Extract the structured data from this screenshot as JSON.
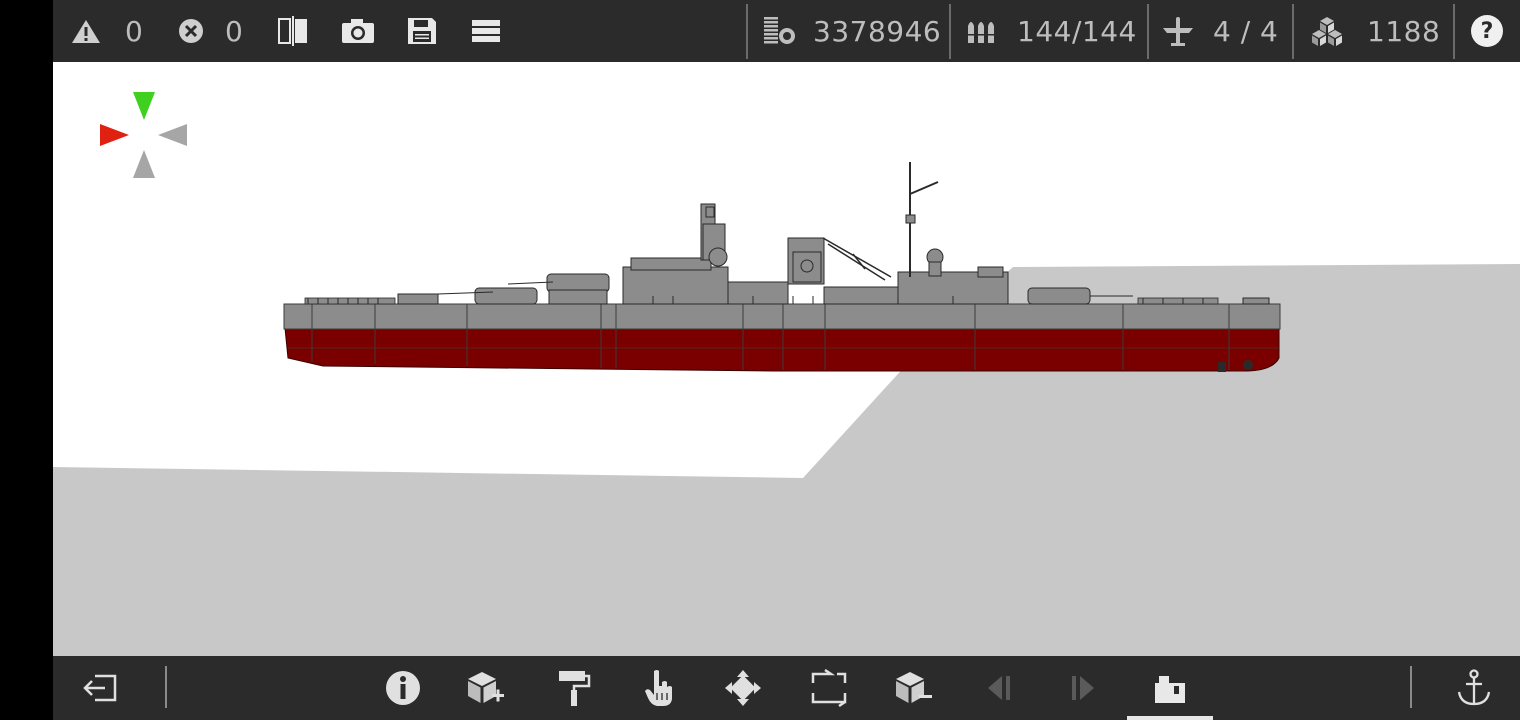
{
  "topbar": {
    "warnings_count": "0",
    "errors_count": "0",
    "cost_value": "3378946",
    "ammo_value": "144/144",
    "aircraft_value": "4 / 4",
    "parts_value": "1188",
    "help_label": "?"
  },
  "colors": {
    "bar_background": "#2b2b2b",
    "hull_upper": "#8c8c8c",
    "hull_lower": "#7a0000",
    "water_plane": "#c8c8c8",
    "axis_red": "#e02010",
    "axis_green": "#3fd020",
    "axis_gray": "#a6a6a6"
  },
  "bottombar": {
    "active_tool": "view-mode"
  },
  "icons": {
    "top": [
      "warning-icon",
      "error-icon",
      "mirror-icon",
      "camera-icon",
      "save-icon",
      "menu-icon",
      "cost-icon",
      "ammo-icon",
      "aircraft-icon",
      "parts-icon",
      "help-icon"
    ],
    "bottom": [
      "exit-icon",
      "info-icon",
      "add-part-icon",
      "paint-icon",
      "select-icon",
      "move-icon",
      "transform-icon",
      "remove-part-icon",
      "previous-icon",
      "next-icon",
      "view-mode-icon",
      "anchor-icon"
    ]
  }
}
